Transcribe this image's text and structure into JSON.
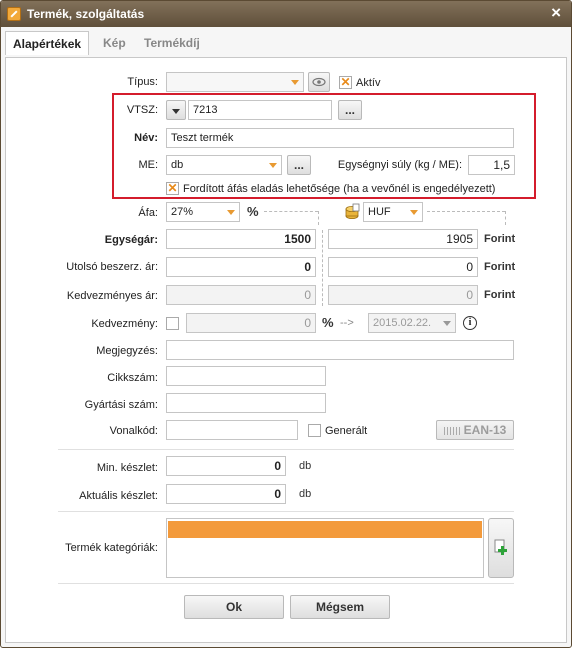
{
  "window": {
    "title": "Termék, szolgáltatás"
  },
  "tabs": [
    "Alapértékek",
    "Kép",
    "Termékdíj"
  ],
  "form": {
    "tipus": {
      "label": "Típus:",
      "value": ""
    },
    "aktiv": {
      "label": "Aktív",
      "checked": true
    },
    "vtsz": {
      "label": "VTSZ:",
      "value": "7213",
      "browse": "..."
    },
    "nev": {
      "label": "Név:",
      "value": "Teszt termék"
    },
    "me": {
      "label": "ME:",
      "value": "db",
      "browse": "..."
    },
    "suly": {
      "label": "Egységnyi súly (kg / ME):",
      "value": "1,5"
    },
    "forditott": {
      "label": "Fordított áfás eladás lehetősége (ha a vevőnél is engedélyezett)",
      "checked": true
    },
    "afa": {
      "label": "Áfa:",
      "value": "27%",
      "unit": "%"
    },
    "currency": {
      "value": "HUF"
    },
    "egysegar": {
      "label": "Egységár:",
      "net": "1500",
      "gross": "1905",
      "unit": "Forint"
    },
    "beszerz": {
      "label": "Utolsó beszerz. ár:",
      "net": "0",
      "gross": "0",
      "unit": "Forint"
    },
    "kedvezmenyes_ar": {
      "label": "Kedvezményes ár:",
      "net": "0",
      "gross": "0",
      "unit": "Forint"
    },
    "kedvezmeny": {
      "label": "Kedvezmény:",
      "value": "0",
      "unit": "%",
      "arrow": "-->",
      "date": "2015.02.22."
    },
    "megjegyzes": {
      "label": "Megjegyzés:",
      "value": ""
    },
    "cikkszam": {
      "label": "Cikkszám:",
      "value": ""
    },
    "gyartasi": {
      "label": "Gyártási szám:",
      "value": ""
    },
    "vonalkod": {
      "label": "Vonalkód:",
      "value": "",
      "generalt": "Generált",
      "ean": "EAN-13"
    },
    "min_keszlet": {
      "label": "Min. készlet:",
      "value": "0",
      "unit": "db"
    },
    "aktualis_keszlet": {
      "label": "Aktuális készlet:",
      "value": "0",
      "unit": "db"
    },
    "kategoria": {
      "label": "Termék kategóriák:"
    }
  },
  "buttons": {
    "ok": "Ok",
    "cancel": "Mégsem"
  },
  "colors": {
    "accent": "#e89a32",
    "highlight": "#d41c2c",
    "title_bar": "#6b5a44"
  }
}
